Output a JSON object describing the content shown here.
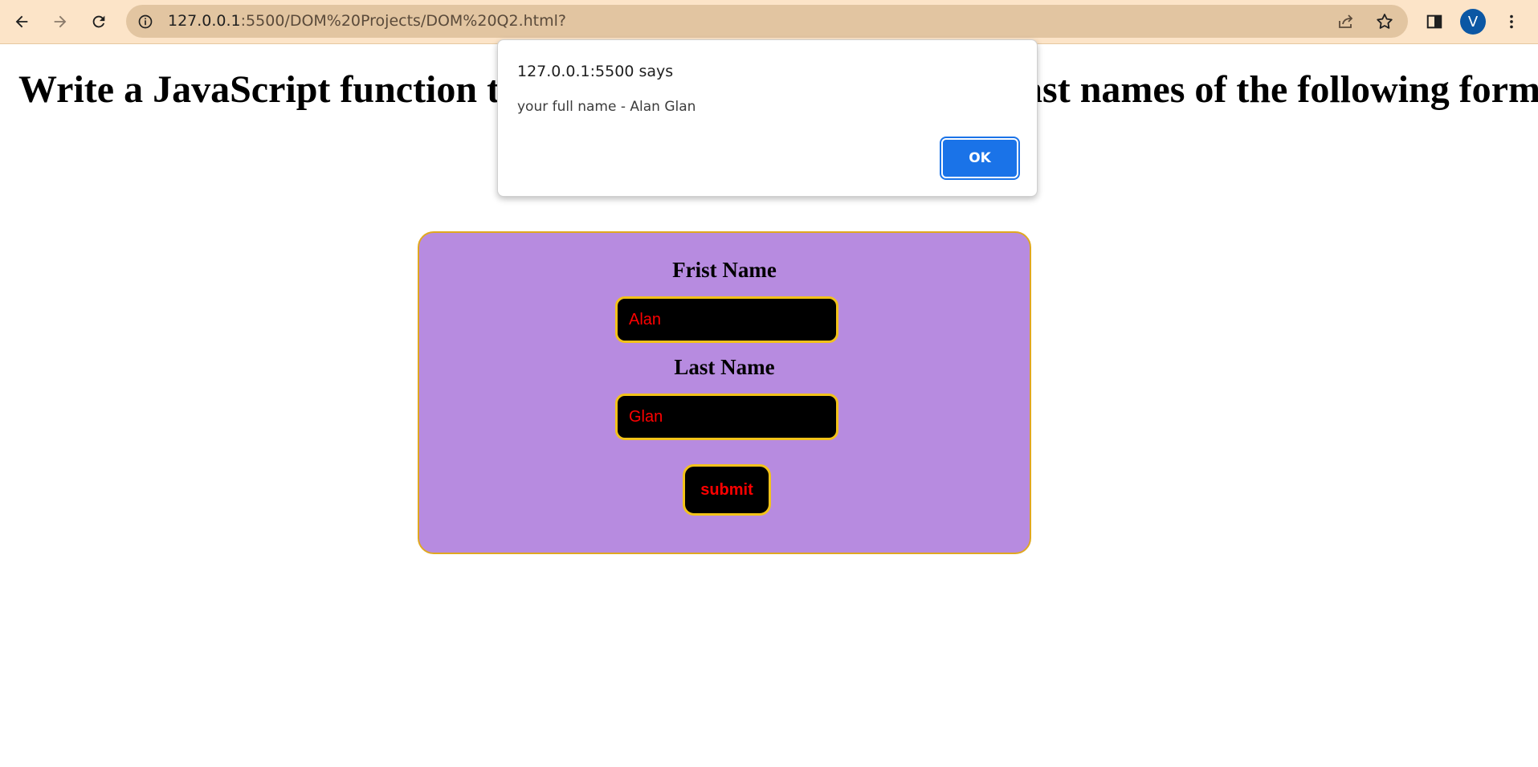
{
  "browser": {
    "url_host": "127.0.0.1",
    "url_path": ":5500/DOM%20Projects/DOM%20Q2.html?",
    "profile_initial": "V",
    "icons": {
      "back": "arrow-left-icon",
      "forward": "arrow-right-icon",
      "reload": "reload-icon",
      "site_info": "info-icon",
      "share": "share-icon",
      "bookmark": "star-icon",
      "side_panel": "side-panel-icon",
      "menu": "kebab-menu-icon"
    }
  },
  "page": {
    "heading": "Write a JavaScript function that get the values of First and Last names of the following form.",
    "form": {
      "first_name_label": "Frist Name",
      "first_name_value": "Alan",
      "last_name_label": "Last Name",
      "last_name_value": "Glan",
      "submit_label": "submit"
    }
  },
  "alert": {
    "origin": "127.0.0.1:5500 says",
    "message": "your full name - Alan Glan",
    "ok_label": "OK"
  },
  "colors": {
    "toolbar": "#fce4c8",
    "omnibox": "#e2c5a1",
    "form_background": "#b78be0",
    "form_border": "#e0a820",
    "input_background": "#000000",
    "input_text": "#ff0000",
    "input_border": "#f2c21a",
    "ok_button": "#1a73e8",
    "avatar": "#0b57a4"
  }
}
